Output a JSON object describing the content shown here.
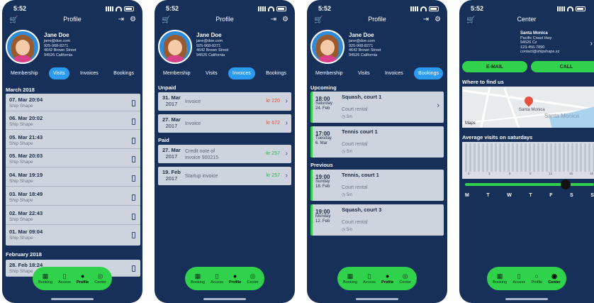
{
  "status": {
    "time": "5:52"
  },
  "profile": {
    "nav_title": "Profile",
    "name": "Jane Doe",
    "email": "jane@doe.com",
    "phone": "925-968-8271",
    "street": "4642 Brown Street",
    "city": "94526 California"
  },
  "profile_tabs": [
    "Membership",
    "Visits",
    "Invoices",
    "Bookings"
  ],
  "visits": {
    "month1": "March 2018",
    "items": [
      {
        "date": "07. Mar 20:04",
        "place": "Ship Shape"
      },
      {
        "date": "06. Mar 20:02",
        "place": "Ship Shape"
      },
      {
        "date": "05. Mar 21:43",
        "place": "Ship Shape"
      },
      {
        "date": "05. Mar 20:03",
        "place": "Ship Shape"
      },
      {
        "date": "04. Mar 19:19",
        "place": "Ship Shape"
      },
      {
        "date": "03. Mar 18:49",
        "place": "Ship Shape"
      },
      {
        "date": "02. Mar 22:43",
        "place": "Ship Shape"
      },
      {
        "date": "01. Mar 09:04",
        "place": "Ship Shape"
      }
    ],
    "month2": "February 2018",
    "last": {
      "date": "28. Feb 18:24",
      "place": "Ship Shape"
    }
  },
  "invoices": {
    "unpaid_label": "Unpaid",
    "paid_label": "Paid",
    "unpaid": [
      {
        "day": "31. Mar",
        "year": "2017",
        "desc": "Invoice",
        "amount": "kr 220"
      },
      {
        "day": "27. Mar",
        "year": "2017",
        "desc": "Invoice",
        "amount": "kr 672"
      }
    ],
    "paid": [
      {
        "day": "27. Mar",
        "year": "2017",
        "desc1": "Credit note of",
        "desc2": "invoice 900215",
        "amount": "-kr 257"
      },
      {
        "day": "19. Feb",
        "year": "2017",
        "desc1": "Startup invoice",
        "desc2": "",
        "amount": "kr 257"
      }
    ]
  },
  "bookings": {
    "upcoming_label": "Upcoming",
    "previous_label": "Previous",
    "upcoming": [
      {
        "time": "18:00",
        "weekday": "Saturday",
        "date": "24. Feb",
        "title": "Squash, court 1",
        "sub": "Court rental",
        "dur": "5m"
      },
      {
        "time": "17:00",
        "weekday": "Tuesday",
        "date": "6. Mar",
        "title": "Tennis court 1",
        "sub": "Court rental",
        "dur": "5m"
      }
    ],
    "previous": [
      {
        "time": "19:00",
        "weekday": "Sunday",
        "date": "18. Feb",
        "title": "Tennis, court 1",
        "sub": "Court rental",
        "dur": "5m"
      },
      {
        "time": "19:00",
        "weekday": "Monday",
        "date": "12. Feb",
        "title": "Squash, court 3",
        "sub": "Court rental",
        "dur": "5m"
      }
    ]
  },
  "center": {
    "nav_title": "Center",
    "name": "Santa Monica",
    "line1": "Pacific Coast Hwy",
    "line2": "94526 Cz",
    "phone": "123-456-7890",
    "email": "contact@shipshape.xz",
    "email_btn": "E-MAIL",
    "call_btn": "CALL",
    "where_label": "Where to find us",
    "map_city": "Santa Monica",
    "map_city2": "Santa Monica",
    "maps_label": "Maps",
    "visits_label": "Average visits on saturdays",
    "ticks": [
      "0",
      "3",
      "6",
      "9",
      "12",
      "15",
      "18"
    ],
    "days": [
      "M",
      "T",
      "W",
      "T",
      "F",
      "S",
      "S"
    ]
  },
  "tabbar": [
    "Booking",
    "Access",
    "Profile",
    "Center"
  ],
  "colors": {
    "bg": "#17305a",
    "accent": "#2fd24a",
    "active_tab": "#2b9bef"
  }
}
